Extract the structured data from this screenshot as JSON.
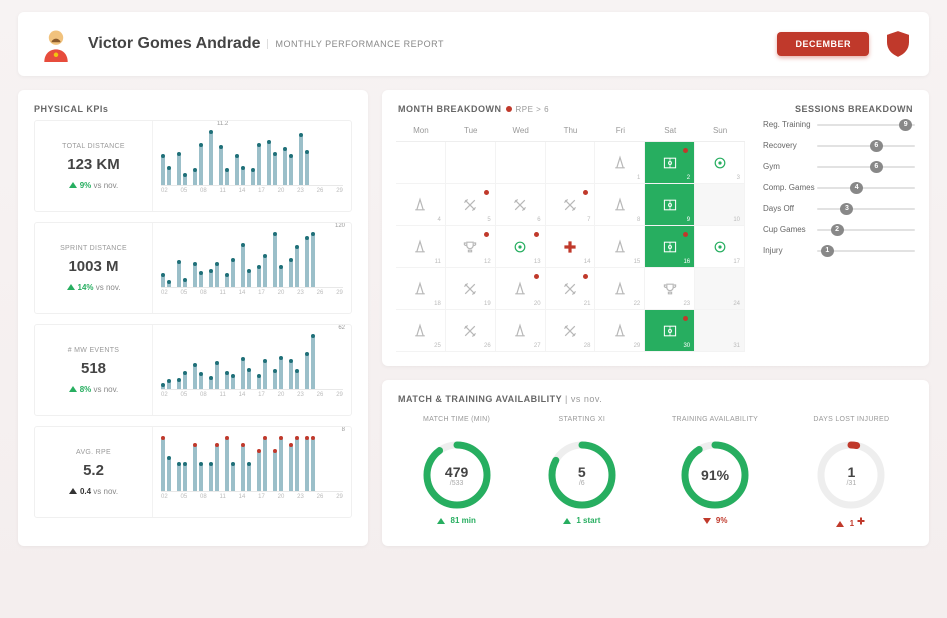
{
  "header": {
    "name": "Victor Gomes Andrade",
    "subtitle": "MONTHLY PERFORMANCE REPORT",
    "month_button": "DECEMBER"
  },
  "panels": {
    "kpis_title": "PHYSICAL KPIs",
    "breakdown_title": "MONTH BREAKDOWN",
    "rpe_legend": "RPE > 6",
    "sessions_title": "SESSIONS BREAKDOWN",
    "avail_title": "MATCH & TRAINING AVAILABILITY",
    "avail_compare": "| vs nov."
  },
  "kpis": [
    {
      "label": "TOTAL DISTANCE",
      "value": "123 KM",
      "delta": "9%",
      "delta_suffix": " vs nov.",
      "dir": "up",
      "peak": "11.2"
    },
    {
      "label": "SPRINT DISTANCE",
      "value": "1003 M",
      "delta": "14%",
      "delta_suffix": " vs nov.",
      "dir": "up",
      "peak": "120"
    },
    {
      "label": "# MW EVENTS",
      "value": "518",
      "delta": "8%",
      "delta_suffix": " vs nov.",
      "dir": "up",
      "peak": "62"
    },
    {
      "label": "Avg. RPE",
      "value": "5.2",
      "delta": "0.4",
      "delta_suffix": " vs nov.",
      "dir": "flat",
      "peak": "8"
    }
  ],
  "calendar": {
    "weekdays": [
      "Mon",
      "Tue",
      "Wed",
      "Thu",
      "Fri",
      "Sat",
      "Sun"
    ],
    "cells": [
      {
        "d": "",
        "t": ""
      },
      {
        "d": "",
        "t": ""
      },
      {
        "d": "",
        "t": ""
      },
      {
        "d": "",
        "t": ""
      },
      {
        "d": "1",
        "t": "cone"
      },
      {
        "d": "2",
        "t": "match",
        "rpe": true
      },
      {
        "d": "3",
        "t": "recovery"
      },
      {
        "d": "4",
        "t": "cone"
      },
      {
        "d": "5",
        "t": "gym",
        "rpe": true
      },
      {
        "d": "6",
        "t": "gym"
      },
      {
        "d": "7",
        "t": "gym",
        "rpe": true
      },
      {
        "d": "8",
        "t": "cone"
      },
      {
        "d": "9",
        "t": "match"
      },
      {
        "d": "10",
        "t": "rest"
      },
      {
        "d": "11",
        "t": "cone"
      },
      {
        "d": "12",
        "t": "cup",
        "rpe": true
      },
      {
        "d": "13",
        "t": "recovery",
        "rpe": true
      },
      {
        "d": "14",
        "t": "injury"
      },
      {
        "d": "15",
        "t": "cone"
      },
      {
        "d": "16",
        "t": "match",
        "rpe": true
      },
      {
        "d": "17",
        "t": "recovery"
      },
      {
        "d": "18",
        "t": "cone"
      },
      {
        "d": "19",
        "t": "gym"
      },
      {
        "d": "20",
        "t": "cone",
        "rpe": true
      },
      {
        "d": "21",
        "t": "gym",
        "rpe": true
      },
      {
        "d": "22",
        "t": "cone"
      },
      {
        "d": "23",
        "t": "cup"
      },
      {
        "d": "24",
        "t": "rest"
      },
      {
        "d": "25",
        "t": "cone"
      },
      {
        "d": "26",
        "t": "gym"
      },
      {
        "d": "27",
        "t": "cone"
      },
      {
        "d": "28",
        "t": "gym"
      },
      {
        "d": "29",
        "t": "cone"
      },
      {
        "d": "30",
        "t": "match",
        "rpe": true
      },
      {
        "d": "31",
        "t": "rest"
      }
    ]
  },
  "sessions": [
    {
      "label": "Reg. Training",
      "value": 9,
      "max": 10
    },
    {
      "label": "Recovery",
      "value": 6,
      "max": 10
    },
    {
      "label": "Gym",
      "value": 6,
      "max": 10
    },
    {
      "label": "Comp. Games",
      "value": 4,
      "max": 10
    },
    {
      "label": "Days Off",
      "value": 3,
      "max": 10
    },
    {
      "label": "Cup Games",
      "value": 2,
      "max": 10
    },
    {
      "label": "Injury",
      "value": 1,
      "max": 10
    }
  ],
  "availability": [
    {
      "title": "MATCH TIME (MIN)",
      "big": "479",
      "small": "/533",
      "pct": 0.9,
      "color": "#27ae60",
      "delta": "81 min",
      "dir": "up"
    },
    {
      "title": "STARTING XI",
      "big": "5",
      "small": "/6",
      "pct": 0.83,
      "color": "#27ae60",
      "delta": "1 start",
      "dir": "up"
    },
    {
      "title": "TRAINING AVAILABILITY",
      "big": "91%",
      "small": "",
      "pct": 0.91,
      "color": "#27ae60",
      "delta": "9%",
      "dir": "down"
    },
    {
      "title": "DAYS LOST INJURED",
      "big": "1",
      "small": "/31",
      "pct": 0.03,
      "color": "#c0392b",
      "delta": "1",
      "dir": "up-red",
      "icon": "cross"
    }
  ],
  "chart_data": {
    "x_ticks": [
      "02",
      "05",
      "08",
      "11",
      "14",
      "17",
      "20",
      "23",
      "26",
      "29"
    ],
    "charts": [
      {
        "type": "bar",
        "title": "TOTAL DISTANCE",
        "ylabel": "km",
        "sessions": [
          [
            6.0,
            3.5
          ],
          [
            6.5,
            2.0
          ],
          [
            3.0,
            8.5
          ],
          [
            11.2
          ],
          [
            8.0,
            3.0
          ],
          [
            6.0,
            3.5
          ],
          [
            3.0,
            8.5
          ],
          [
            9.0,
            6.5
          ],
          [
            7.5,
            6.0
          ],
          [
            10.5,
            7.0
          ]
        ],
        "peak": 11.2
      },
      {
        "type": "bar",
        "title": "SPRINT DISTANCE",
        "ylabel": "m",
        "sessions": [
          [
            25,
            10
          ],
          [
            55,
            15
          ],
          [
            50,
            30
          ],
          [
            35,
            50
          ],
          [
            25,
            60
          ],
          [
            95,
            35
          ],
          [
            45,
            70
          ],
          [
            120,
            45
          ],
          [
            60,
            90
          ],
          [
            110,
            120
          ]
        ],
        "peak": 120
      },
      {
        "type": "bar",
        "title": "# MW EVENTS",
        "ylabel": "count",
        "sessions": [
          [
            3,
            8
          ],
          [
            10,
            18
          ],
          [
            28,
            17
          ],
          [
            12,
            30
          ],
          [
            18,
            14
          ],
          [
            35,
            22
          ],
          [
            14,
            32
          ],
          [
            20,
            36
          ],
          [
            32,
            20
          ],
          [
            40,
            62
          ]
        ],
        "peak": 62
      },
      {
        "type": "bar",
        "title": "Avg. RPE",
        "ylabel": "rpe",
        "sessions": [
          [
            8,
            5
          ],
          [
            4,
            4
          ],
          [
            7,
            4
          ],
          [
            4,
            7
          ],
          [
            8,
            4
          ],
          [
            7,
            4
          ],
          [
            6,
            8
          ],
          [
            6,
            8
          ],
          [
            7,
            8
          ],
          [
            8,
            8
          ]
        ],
        "peak": 8,
        "threshold": 6
      }
    ]
  }
}
